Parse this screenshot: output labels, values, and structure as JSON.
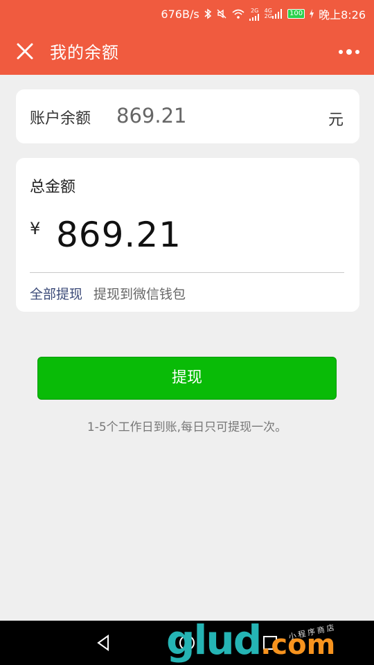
{
  "status_bar": {
    "network_speed": "676B/s",
    "sig1": "2G",
    "sig2": "4G\n2G",
    "battery": "100",
    "time": "晚上8:26"
  },
  "nav": {
    "title": "我的余额"
  },
  "balance_card": {
    "label": "账户余额",
    "amount": "869.21",
    "unit": "元"
  },
  "total_card": {
    "title": "总金额",
    "currency": "¥",
    "amount": "869.21",
    "withdraw_all": "全部提现",
    "hint": "提现到微信钱包"
  },
  "withdraw_button": "提现",
  "note": "1-5个工作日到账,每日只可提现一次。",
  "watermark": {
    "main": "glud",
    "suffix": ".com",
    "small": "小程序商店"
  },
  "colors": {
    "accent": "#f05b3f",
    "button": "#09bb07"
  }
}
